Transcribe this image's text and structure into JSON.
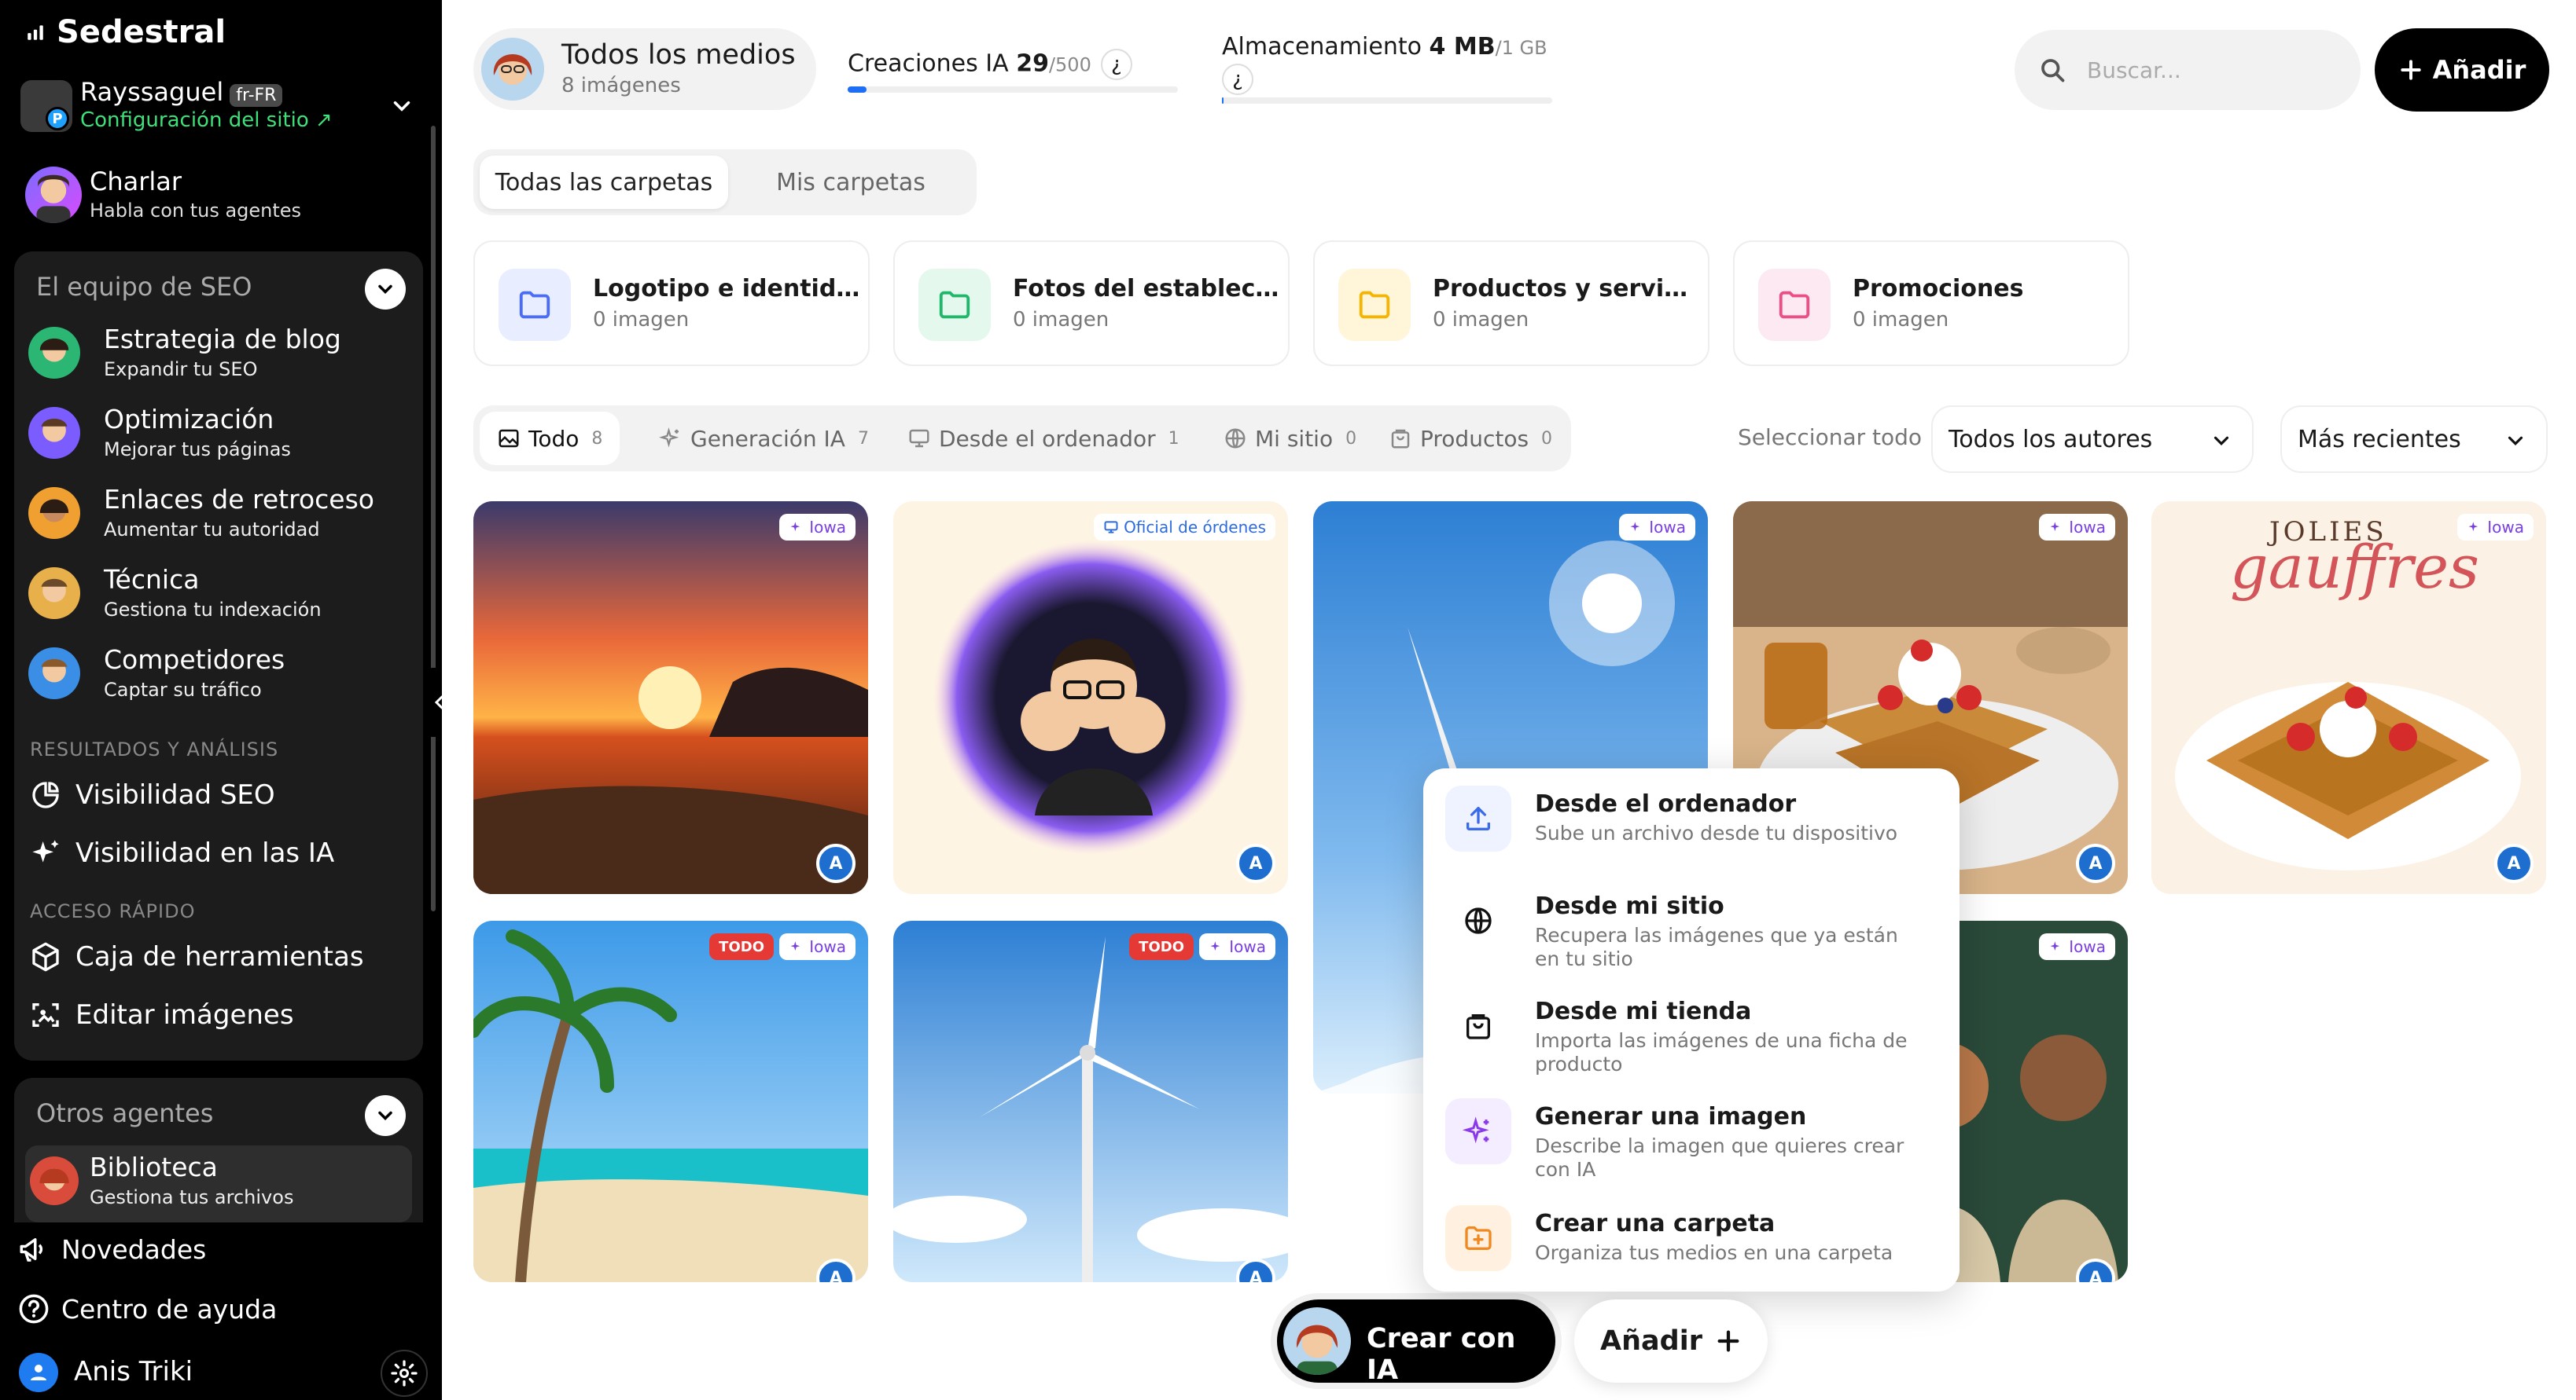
{
  "sidebar": {
    "brand": "Sedestral",
    "site": {
      "name": "Rayssaguel",
      "lang": "fr-FR",
      "config": "Configuración del sitio ↗"
    },
    "chat": {
      "title": "Charlar",
      "subtitle": "Habla con tus agentes"
    },
    "seo_team": {
      "title": "El equipo de SEO",
      "agents": [
        {
          "title": "Estrategia de blog",
          "subtitle": "Expandir tu SEO"
        },
        {
          "title": "Optimización",
          "subtitle": "Mejorar tus páginas"
        },
        {
          "title": "Enlaces de retroceso",
          "subtitle": "Aumentar tu autoridad"
        },
        {
          "title": "Técnica",
          "subtitle": "Gestiona tu indexación"
        },
        {
          "title": "Competidores",
          "subtitle": "Captar su tráfico"
        }
      ],
      "results_header": "RESULTADOS Y ANÁLISIS",
      "results": [
        {
          "label": "Visibilidad SEO",
          "icon": "pie-chart-icon"
        },
        {
          "label": "Visibilidad en las IA",
          "icon": "sparkle-icon"
        }
      ],
      "quick_header": "ACCESO RÁPIDO",
      "quick": [
        {
          "label": "Caja de herramientas",
          "icon": "cube-icon"
        },
        {
          "label": "Editar imágenes",
          "icon": "image-edit-icon"
        }
      ]
    },
    "others": {
      "title": "Otros agentes",
      "library": {
        "title": "Biblioteca",
        "subtitle": "Gestiona tus archivos"
      }
    },
    "bottom": [
      {
        "label": "Novedades",
        "icon": "megaphone-icon"
      },
      {
        "label": "Centro de ayuda",
        "icon": "help-icon"
      }
    ],
    "user": {
      "name": "Anis Triki"
    }
  },
  "header": {
    "all_media": {
      "title": "Todos los medios",
      "count": "8 imágenes"
    },
    "ai_creations": {
      "label": "Creaciones IA",
      "value": "29",
      "max": "/500",
      "fraction": 0.058,
      "help": "¿"
    },
    "storage": {
      "label": "Almacenamiento",
      "value": "4 MB",
      "max": "/1 GB",
      "fraction": 0.004,
      "help": "¿"
    },
    "search_placeholder": "Buscar...",
    "add_label": "Añadir"
  },
  "folder_tabs": [
    {
      "label": "Todas las carpetas",
      "active": true
    },
    {
      "label": "Mis carpetas",
      "active": false
    }
  ],
  "folders": [
    {
      "title": "Logotipo e identidad",
      "count": "0 imagen",
      "color": "#4a6cf7",
      "bg": "#e8edff"
    },
    {
      "title": "Fotos del estableci...",
      "count": "0 imagen",
      "color": "#1fb86a",
      "bg": "#e4f8ee"
    },
    {
      "title": "Productos y servicios",
      "count": "0 imagen",
      "color": "#f5b400",
      "bg": "#fff5d9"
    },
    {
      "title": "Promociones",
      "count": "0 imagen",
      "color": "#ec4f86",
      "bg": "#fde9f1"
    }
  ],
  "filters": [
    {
      "label": "Todo",
      "count": "8",
      "icon": "image-icon",
      "active": true
    },
    {
      "label": "Generación IA",
      "count": "7",
      "icon": "sparkle-icon",
      "active": false
    },
    {
      "label": "Desde el ordenador",
      "count": "1",
      "icon": "monitor-icon",
      "active": false
    },
    {
      "label": "Mi sitio",
      "count": "0",
      "icon": "globe-icon",
      "active": false
    },
    {
      "label": "Productos",
      "count": "0",
      "icon": "bag-icon",
      "active": false
    }
  ],
  "select_all": "Seleccionar todo",
  "authors_dropdown": "Todos los autores",
  "sort_dropdown": "Más recientes",
  "cards": [
    {
      "tag": "Iowa",
      "todo": "",
      "badge": "A",
      "scene": "sunset"
    },
    {
      "tag": "Oficial de órdenes",
      "todo": "",
      "badge": "A",
      "scene": "avatar"
    },
    {
      "tag": "Iowa",
      "todo": "",
      "badge": "",
      "scene": "sky"
    },
    {
      "tag": "Iowa",
      "todo": "",
      "badge": "A",
      "scene": "waffles"
    },
    {
      "tag": "Iowa",
      "todo": "",
      "badge": "A",
      "scene": "gauffres",
      "text1": "JOLIES",
      "text2": "gauffres"
    },
    {
      "tag": "Iowa",
      "todo": "TODO",
      "badge": "A",
      "scene": "beach"
    },
    {
      "tag": "Iowa",
      "todo": "TODO",
      "badge": "A",
      "scene": "wind"
    },
    {
      "tag": "Iowa",
      "todo": "",
      "badge": "A",
      "scene": "people"
    }
  ],
  "add_menu": [
    {
      "title": "Desde el ordenador",
      "desc": "Sube un archivo desde tu dispositivo",
      "icon": "upload-icon"
    },
    {
      "title": "Desde mi sitio",
      "desc": "Recupera las imágenes que ya están en tu sitio",
      "icon": "globe-icon"
    },
    {
      "title": "Desde mi tienda",
      "desc": "Importa las imágenes de una ficha de producto",
      "icon": "bag-icon"
    },
    {
      "title": "Generar una imagen",
      "desc": "Describe la imagen que quieres crear con IA",
      "icon": "sparkle-icon"
    },
    {
      "title": "Crear una carpeta",
      "desc": "Organiza tus medios en una carpeta",
      "icon": "folder-plus-icon"
    }
  ],
  "bottom_actions": {
    "create_ai": "Crear con IA",
    "add": "Añadir"
  }
}
